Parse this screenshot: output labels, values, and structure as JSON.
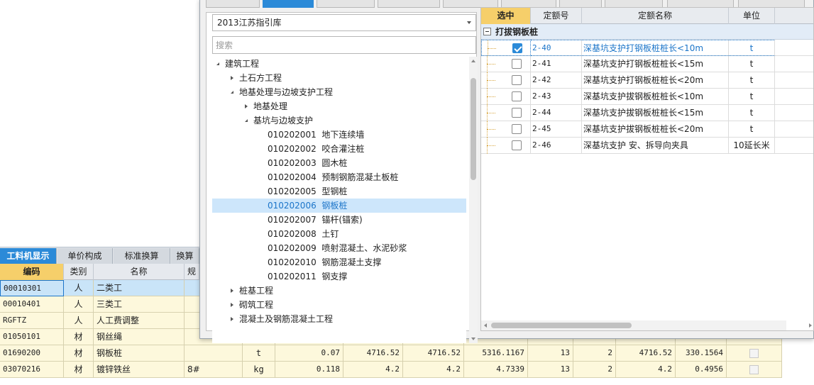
{
  "bottom_tabs": [
    "工料机显示",
    "单价构成",
    "标准换算",
    "换算"
  ],
  "bottom_table": {
    "headers": [
      "编码",
      "类别",
      "名称",
      "规"
    ],
    "rows": [
      {
        "code": "00010301",
        "type": "人",
        "name": "二类工",
        "spec": "",
        "unit": "",
        "qty": "",
        "p1": "",
        "p2": "",
        "p3": "",
        "n1": "",
        "n2": "",
        "p4": "",
        "p5": "",
        "selected": true
      },
      {
        "code": "00010401",
        "type": "人",
        "name": "三类工",
        "spec": "",
        "unit": "",
        "qty": "",
        "p1": "",
        "p2": "",
        "p3": "",
        "n1": "",
        "n2": "",
        "p4": "",
        "p5": ""
      },
      {
        "code": "RGFTZ",
        "type": "人",
        "name": "人工费调整",
        "spec": "",
        "unit": "",
        "qty": "",
        "p1": "",
        "p2": "",
        "p3": "",
        "n1": "",
        "n2": "",
        "p4": "",
        "p5": ""
      },
      {
        "code": "01050101",
        "type": "材",
        "name": "钢丝绳",
        "spec": "",
        "unit": "",
        "qty": "",
        "p1": "",
        "p2": "",
        "p3": "",
        "n1": "",
        "n2": "",
        "p4": "",
        "p5": ""
      },
      {
        "code": "01690200",
        "type": "材",
        "name": "钢板桩",
        "spec": "",
        "unit": "t",
        "qty": "0.07",
        "p1": "4716.52",
        "p2": "4716.52",
        "p3": "5316.1167",
        "n1": "13",
        "n2": "2",
        "p4": "4716.52",
        "p5": "330.1564"
      },
      {
        "code": "03070216",
        "type": "材",
        "name": "镀锌铁丝",
        "spec": "8#",
        "unit": "kg",
        "qty": "0.118",
        "p1": "4.2",
        "p2": "4.2",
        "p3": "4.7339",
        "n1": "13",
        "n2": "2",
        "p4": "4.2",
        "p5": "0.4956"
      }
    ]
  },
  "dialog": {
    "library": "2013江苏指引库",
    "search_placeholder": "搜索",
    "tree": [
      {
        "label": "建筑工程",
        "level": 0,
        "toggle": "expanded"
      },
      {
        "label": "土石方工程",
        "level": 1,
        "toggle": "collapsed"
      },
      {
        "label": "地基处理与边坡支护工程",
        "level": 1,
        "toggle": "expanded"
      },
      {
        "label": "地基处理",
        "level": 2,
        "toggle": "collapsed"
      },
      {
        "label": "基坑与边坡支护",
        "level": 2,
        "toggle": "expanded"
      },
      {
        "label": "010202001  地下连续墙",
        "level": 3,
        "toggle": "none"
      },
      {
        "label": "010202002  咬合灌注桩",
        "level": 3,
        "toggle": "none"
      },
      {
        "label": "010202003  圆木桩",
        "level": 3,
        "toggle": "none"
      },
      {
        "label": "010202004  预制钢筋混凝土板桩",
        "level": 3,
        "toggle": "none"
      },
      {
        "label": "010202005  型钢桩",
        "level": 3,
        "toggle": "none"
      },
      {
        "label": "010202006  钢板桩",
        "level": 3,
        "toggle": "none",
        "selected": true
      },
      {
        "label": "010202007  锚杆(锚索)",
        "level": 3,
        "toggle": "none"
      },
      {
        "label": "010202008  土钉",
        "level": 3,
        "toggle": "none"
      },
      {
        "label": "010202009  喷射混凝土、水泥砂浆",
        "level": 3,
        "toggle": "none"
      },
      {
        "label": "010202010  钢筋混凝土支撑",
        "level": 3,
        "toggle": "none"
      },
      {
        "label": "010202011  钢支撑",
        "level": 3,
        "toggle": "none"
      },
      {
        "label": "桩基工程",
        "level": 1,
        "toggle": "collapsed"
      },
      {
        "label": "砌筑工程",
        "level": 1,
        "toggle": "collapsed"
      },
      {
        "label": "混凝土及钢筋混凝土工程",
        "level": 1,
        "toggle": "collapsed"
      }
    ],
    "quota": {
      "headers": {
        "select": "选中",
        "code": "定额号",
        "name": "定额名称",
        "unit": "单位"
      },
      "group": "打拔钢板桩",
      "rows": [
        {
          "code": "2-40",
          "name": "深基坑支护打钢板桩桩长<10m",
          "unit": "t",
          "checked": true,
          "selected": true
        },
        {
          "code": "2-41",
          "name": "深基坑支护打钢板桩桩长<15m",
          "unit": "t",
          "checked": false
        },
        {
          "code": "2-42",
          "name": "深基坑支护打钢板桩桩长<20m",
          "unit": "t",
          "checked": false
        },
        {
          "code": "2-43",
          "name": "深基坑支护拔钢板桩桩长<10m",
          "unit": "t",
          "checked": false
        },
        {
          "code": "2-44",
          "name": "深基坑支护拔钢板桩桩长<15m",
          "unit": "t",
          "checked": false
        },
        {
          "code": "2-45",
          "name": "深基坑支护拔钢板桩桩长<20m",
          "unit": "t",
          "checked": false
        },
        {
          "code": "2-46",
          "name": "深基坑支护 安、拆导向夹具",
          "unit": "10延长米",
          "checked": false
        }
      ]
    }
  }
}
